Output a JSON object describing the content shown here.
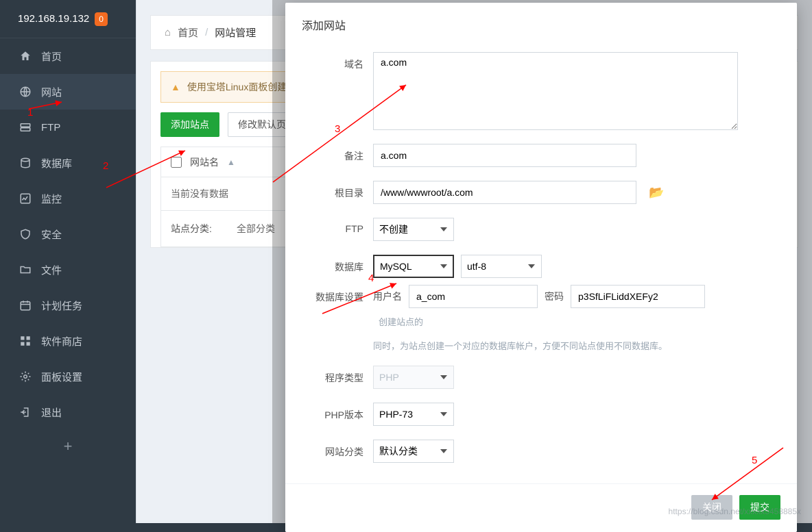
{
  "header": {
    "ip": "192.168.19.132",
    "msg_count": "0"
  },
  "sidebar": {
    "items": [
      {
        "label": "首页"
      },
      {
        "label": "网站"
      },
      {
        "label": "FTP"
      },
      {
        "label": "数据库"
      },
      {
        "label": "监控"
      },
      {
        "label": "安全"
      },
      {
        "label": "文件"
      },
      {
        "label": "计划任务"
      },
      {
        "label": "软件商店"
      },
      {
        "label": "面板设置"
      },
      {
        "label": "退出"
      }
    ]
  },
  "breadcrumb": {
    "home": "首页",
    "current": "网站管理"
  },
  "alert": "使用宝塔Linux面板创建",
  "toolbar": {
    "add_site": "添加站点",
    "modify_default": "修改默认页"
  },
  "table": {
    "col_site_name": "网站名",
    "empty": "当前没有数据"
  },
  "filter": {
    "label": "站点分类:",
    "value": "全部分类"
  },
  "modal": {
    "title": "添加网站",
    "labels": {
      "domain": "域名",
      "remark": "备注",
      "root": "根目录",
      "ftp": "FTP",
      "db": "数据库",
      "db_set": "数据库设置",
      "db_user": "用户名",
      "db_pass": "密码",
      "app_type": "程序类型",
      "php_ver": "PHP版本",
      "category": "网站分类"
    },
    "values": {
      "domain": "a.com",
      "remark": "a.com",
      "root": "/www/wwwroot/a.com",
      "ftp": "不创建",
      "db_type": "MySQL",
      "db_charset": "utf-8",
      "db_user": "a_com",
      "db_pass": "p3SfLiFLiddXEFy2",
      "app_type": "PHP",
      "php_ver": "PHP-73",
      "category": "默认分类"
    },
    "hints": {
      "db": "同时，为站点创建一个对应的数据库帐户，方便不同站点使用不同数据库。",
      "create_side": "创建站点的"
    },
    "buttons": {
      "close": "关闭",
      "submit": "提交"
    }
  },
  "annotations": {
    "a1": "1",
    "a2": "2",
    "a3": "3",
    "a4": "4",
    "a5": "5"
  },
  "watermark": "https://blog.csdn.net/xxxxx5458885x"
}
